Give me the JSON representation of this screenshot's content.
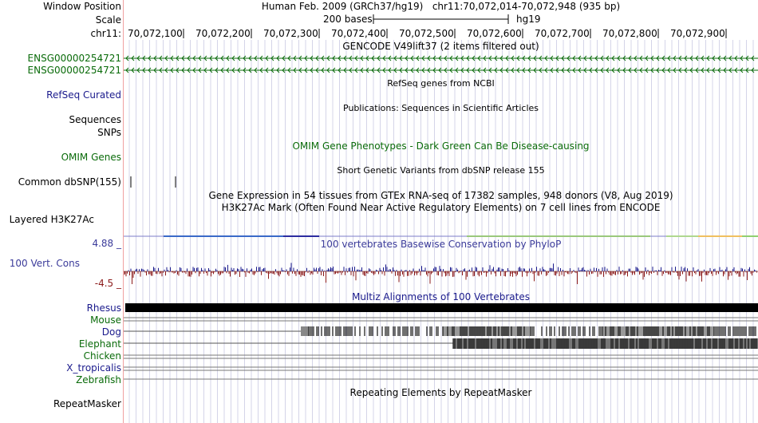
{
  "labels": {
    "window_position": "Window Position",
    "scale": "Scale",
    "chrom": "chr11:",
    "gene1": "ENSG00000254721",
    "gene2": "ENSG00000254721",
    "refseq": "RefSeq Curated",
    "sequences": "Sequences",
    "snps": "SNPs",
    "omim": "OMIM Genes",
    "dbsnp": "Common dbSNP(155)",
    "h3k27ac": "Layered H3K27Ac",
    "phylop_max": "4.88 _",
    "cons": "100 Vert. Cons",
    "phylop_min": "-4.5 _",
    "repeatmasker": "RepeatMasker"
  },
  "species": [
    {
      "name": "Rhesus",
      "color": "#1a1a8c"
    },
    {
      "name": "Mouse",
      "color": "#0a6b0a"
    },
    {
      "name": "Dog",
      "color": "#1a1a8c"
    },
    {
      "name": "Elephant",
      "color": "#0a6b0a"
    },
    {
      "name": "Chicken",
      "color": "#0a6b0a"
    },
    {
      "name": "X_tropicalis",
      "color": "#1a1a8c"
    },
    {
      "name": "Zebrafish",
      "color": "#0a6b0a"
    }
  ],
  "header": {
    "assembly": "Human Feb. 2009 (GRCh37/hg19)",
    "position": "chr11:70,072,014-70,072,948 (935 bp)",
    "scale_text": "200 bases",
    "db": "hg19"
  },
  "ruler": {
    "ticks": [
      "70,072,100",
      "70,072,200",
      "70,072,300",
      "70,072,400",
      "70,072,500",
      "70,072,600",
      "70,072,700",
      "70,072,800",
      "70,072,900"
    ]
  },
  "tracks": {
    "gencode": "GENCODE V49lift37 (2 items filtered out)",
    "refseq": "RefSeq genes from NCBI",
    "publications": "Publications: Sequences in Scientific Articles",
    "omim": "OMIM Gene Phenotypes - Dark Green Can Be Disease-causing",
    "dbsnp": "Short Genetic Variants from dbSNP release 155",
    "gtex": "Gene Expression in 54 tissues from GTEx RNA-seq of 17382 samples, 948 donors (V8, Aug 2019)",
    "h3k27ac": "H3K27Ac Mark (Often Found Near Active Regulatory Elements) on 7 cell lines from ENCODE",
    "phylop": "100 vertebrates Basewise Conservation by PhyloP",
    "multiz": "Multiz Alignments of 100 Vertebrates",
    "repeatmasker": "Repeating Elements by RepeatMasker"
  },
  "colors": {
    "gene": "#0a6b0a",
    "phylop_pos": "#1a1a8c",
    "phylop_neg": "#8b1a1a",
    "grid": "#d4d4e8"
  }
}
